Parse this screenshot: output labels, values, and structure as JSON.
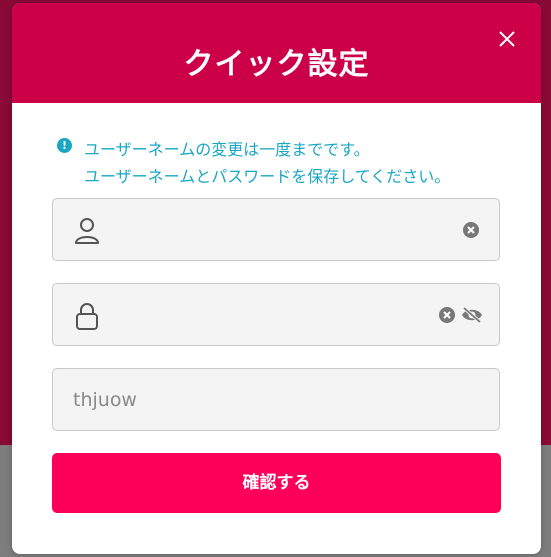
{
  "modal": {
    "title": "クイック設定",
    "close_icon": "close-icon"
  },
  "notice": {
    "icon": "info-icon",
    "line1": "ユーザーネームの変更は一度までです。",
    "line2": "ユーザーネームとパスワードを保存してください。"
  },
  "form": {
    "username": {
      "icon": "user-icon",
      "value": "",
      "clear_icon": "clear-icon"
    },
    "password": {
      "icon": "lock-icon",
      "value": "",
      "clear_icon": "clear-icon",
      "visibility_icon": "eye-slash-icon"
    },
    "extra": {
      "value": "thjuow"
    },
    "confirm_label": "確認する"
  },
  "colors": {
    "header": "#cc0046",
    "accent_button": "#ff0059",
    "notice_text": "#1aa7c4",
    "backdrop": "#8a0a36"
  }
}
